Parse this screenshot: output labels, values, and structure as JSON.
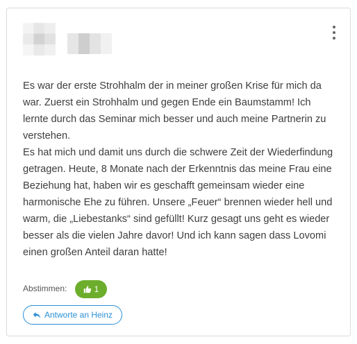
{
  "review": {
    "paragraphs": [
      "Es war der erste Strohhalm der in meiner großen Krise für mich da war. Zuerst ein Strohhalm und gegen Ende ein Baumstamm! Ich lernte durch das Seminar mich besser und auch meine Partnerin zu verstehen.",
      "Es hat mich und damit uns durch die schwere Zeit der Wiederfindung getragen. Heute, 8 Monate nach der Erkenntnis das meine Frau eine Beziehung hat, haben wir es geschafft gemeinsam wieder eine harmonische Ehe zu führen. Unsere „Feuer“ brennen wieder hell und warm, die „Liebestanks“ sind gefüllt! Kurz gesagt uns geht es wieder besser als die vielen Jahre davor! Und ich kann sagen dass Lovomi einen großen Anteil daran hatte!"
    ]
  },
  "votes": {
    "label": "Abstimmen:",
    "count": "1",
    "button_color": "#6cae2c",
    "icon": "thumbs-up-icon"
  },
  "reply": {
    "label": "Antworte an Heinz",
    "icon": "reply-arrow-icon",
    "color": "#2a8fd6"
  },
  "menu": {
    "icon": "more-vertical-icon"
  }
}
